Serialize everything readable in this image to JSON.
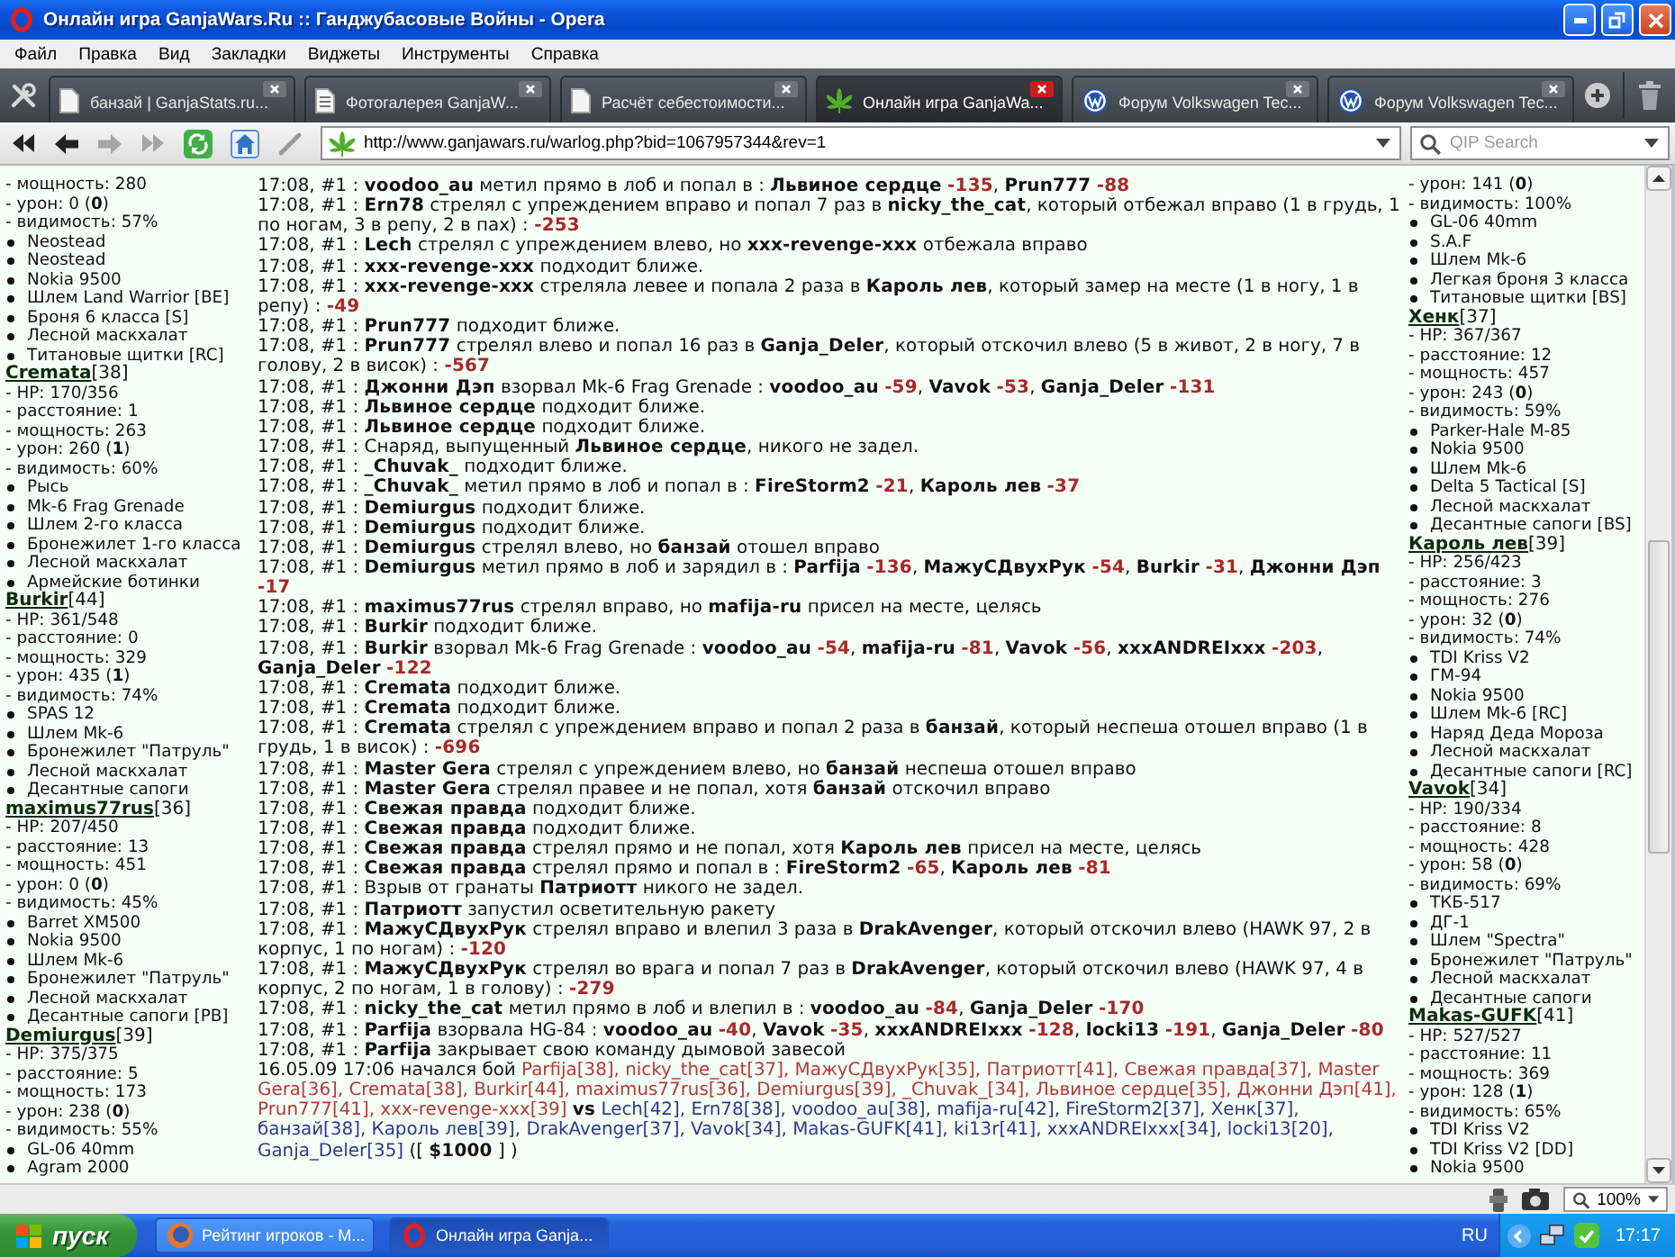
{
  "window": {
    "title": "Онлайн игра GanjaWars.Ru :: Ганджубасовые Войны - Opera"
  },
  "menu": [
    "Файл",
    "Правка",
    "Вид",
    "Закладки",
    "Виджеты",
    "Инструменты",
    "Справка"
  ],
  "tabs": [
    {
      "label": "банзай | GanjaStats.ru...",
      "kind": "page",
      "selected": false
    },
    {
      "label": "Фотогалерея GanjaW...",
      "kind": "document",
      "selected": false
    },
    {
      "label": "Расчёт себестоимости...",
      "kind": "page",
      "selected": false
    },
    {
      "label": "Онлайн игра GanjaWa...",
      "kind": "leaf",
      "selected": true
    },
    {
      "label": "Форум Volkswagen Tec...",
      "kind": "logo",
      "selected": false
    },
    {
      "label": "Форум Volkswagen Tec...",
      "kind": "logo",
      "selected": false
    }
  ],
  "address_bar": {
    "url": "http://www.ganjawars.ru/warlog.php?bid=1067957344&rev=1"
  },
  "search": {
    "placeholder": "QIP Search"
  },
  "left_panel": {
    "fighters": [
      {
        "stats": [
          "- мощность: 280",
          "- урон: 0 (**0**)",
          "- видимость: 57%"
        ],
        "items": [
          "Neostead",
          "Neostead",
          "Nokia 9500",
          "Шлем Land Warrior [BE]",
          "Броня 6 класса [S]",
          "Лесной маскхалат",
          "Титановые щитки [RC]"
        ]
      },
      {
        "name": "Cremata",
        "grade": "[38]",
        "stats": [
          "- HP: 170/356",
          "- расстояние: 1",
          "- мощность: 263",
          "- урон: 260 (**1**)",
          "- видимость: 60%"
        ],
        "items": [
          "Рысь",
          "Mk-6 Frag Grenade",
          "Шлем 2-го класса",
          "Бронежилет 1-го класса",
          "Лесной маскхалат",
          "Армейские ботинки"
        ]
      },
      {
        "name": "Burkir",
        "grade": "[44]",
        "stats": [
          "- HP: 361/548",
          "- расстояние: 0",
          "- мощность: 329",
          "- урон: 435 (**1**)",
          "- видимость: 74%"
        ],
        "items": [
          "SPAS 12",
          "Шлем Mk-6",
          "Бронежилет \"Патруль\"",
          "Лесной маскхалат",
          "Десантные сапоги"
        ]
      },
      {
        "name": "maximus77rus",
        "grade": "[36]",
        "stats": [
          "- HP: 207/450",
          "- расстояние: 13",
          "- мощность: 451",
          "- урон: 0 (**0**)",
          "- видимость: 45%"
        ],
        "items": [
          "Barret XM500",
          "Nokia 9500",
          "Шлем Mk-6",
          "Бронежилет \"Патруль\"",
          "Лесной маскхалат",
          "Десантные сапоги [PB]"
        ]
      },
      {
        "name": "Demiurgus",
        "grade": "[39]",
        "stats": [
          "- HP: 375/375",
          "- расстояние: 5",
          "- мощность: 173",
          "- урон: 238 (**0**)",
          "- видимость: 55%"
        ],
        "items": [
          "GL-06 40mm",
          "Agram 2000"
        ]
      }
    ]
  },
  "log": [
    {
      "time": "17:08, #1 :",
      "parts": [
        {
          "kind": "text",
          "text": "**voodoo_au** метил прямо в лоб и попал в : **Львиное сердце**"
        },
        {
          "kind": "damage",
          "text": "-135"
        },
        {
          "kind": "text",
          "text": ", **Prun777**"
        },
        {
          "kind": "damage",
          "text": "-88"
        }
      ]
    },
    {
      "time": "17:08, #1 :",
      "parts": [
        {
          "kind": "text",
          "text": "**Ern78** стрелял с упреждением вправо и попал 7 раз в **nicky_the_cat**, который отбежал вправо (1 в грудь, 1 по ногам, 3 в репу, 2 в пах) :"
        },
        {
          "kind": "damage",
          "text": "-253"
        }
      ]
    },
    {
      "time": "17:08, #1 :",
      "parts": [
        {
          "kind": "text",
          "text": "**Lech** стрелял с упреждением влево, но **xxx-revenge-xxx** отбежала вправо"
        }
      ]
    },
    {
      "time": "17:08, #1 :",
      "parts": [
        {
          "kind": "text",
          "text": "**xxx-revenge-xxx** подходит ближе."
        }
      ]
    },
    {
      "time": "17:08, #1 :",
      "parts": [
        {
          "kind": "text",
          "text": "**xxx-revenge-xxx** стреляла левее и попала 2 раза в **Кароль лев**, который замер на месте (1 в ногу, 1 в репу) :"
        },
        {
          "kind": "damage",
          "text": "-49"
        }
      ]
    },
    {
      "time": "17:08, #1 :",
      "parts": [
        {
          "kind": "text",
          "text": "**Prun777** подходит ближе."
        }
      ]
    },
    {
      "time": "17:08, #1 :",
      "parts": [
        {
          "kind": "text",
          "text": "**Prun777** стрелял влево и попал 16 раз в **Ganja_Deler**, который отскочил влево (5 в живот, 2 в ногу, 7 в голову, 2 в висок) :"
        },
        {
          "kind": "damage",
          "text": "-567"
        }
      ]
    },
    {
      "time": "17:08, #1 :",
      "parts": [
        {
          "kind": "text",
          "text": "**Джонни Дэп** взорвал Mk-6 Frag Grenade : **voodoo_au**"
        },
        {
          "kind": "damage",
          "text": "-59"
        },
        {
          "kind": "text",
          "text": ", **Vavok**"
        },
        {
          "kind": "damage",
          "text": "-53"
        },
        {
          "kind": "text",
          "text": ", **Ganja_Deler**"
        },
        {
          "kind": "damage",
          "text": "-131"
        }
      ]
    },
    {
      "time": "17:08, #1 :",
      "parts": [
        {
          "kind": "text",
          "text": "**Львиное сердце** подходит ближе."
        }
      ]
    },
    {
      "time": "17:08, #1 :",
      "parts": [
        {
          "kind": "text",
          "text": "**Львиное сердце** подходит ближе."
        }
      ]
    },
    {
      "time": "17:08, #1 :",
      "parts": [
        {
          "kind": "text",
          "text": "Снаряд, выпущенный **Львиное сердце**, никого не задел."
        }
      ]
    },
    {
      "time": "17:08, #1 :",
      "parts": [
        {
          "kind": "text",
          "text": "**_Chuvak_** подходит ближе."
        }
      ]
    },
    {
      "time": "17:08, #1 :",
      "parts": [
        {
          "kind": "text",
          "text": "**_Chuvak_** метил прямо в лоб и попал в : **FireStorm2**"
        },
        {
          "kind": "damage",
          "text": "-21"
        },
        {
          "kind": "text",
          "text": ", **Кароль лев**"
        },
        {
          "kind": "damage",
          "text": "-37"
        }
      ]
    },
    {
      "time": "17:08, #1 :",
      "parts": [
        {
          "kind": "text",
          "text": "**Demiurgus** подходит ближе."
        }
      ]
    },
    {
      "time": "17:08, #1 :",
      "parts": [
        {
          "kind": "text",
          "text": "**Demiurgus** подходит ближе."
        }
      ]
    },
    {
      "time": "17:08, #1 :",
      "parts": [
        {
          "kind": "text",
          "text": "**Demiurgus** стрелял влево, но **банзай** отошел вправо"
        }
      ]
    },
    {
      "time": "17:08, #1 :",
      "parts": [
        {
          "kind": "text",
          "text": "**Demiurgus** метил прямо в лоб и зарядил в : **Parfija**"
        },
        {
          "kind": "damage",
          "text": "-136"
        },
        {
          "kind": "text",
          "text": ", **МажуСДвухРук**"
        },
        {
          "kind": "damage",
          "text": "-54"
        },
        {
          "kind": "text",
          "text": ", **Burkir**"
        },
        {
          "kind": "damage",
          "text": "-31"
        },
        {
          "kind": "text",
          "text": ", **Джонни Дэп**"
        },
        {
          "kind": "damage",
          "text": "-17"
        }
      ]
    },
    {
      "time": "17:08, #1 :",
      "parts": [
        {
          "kind": "text",
          "text": "**maximus77rus** стрелял вправо, но **mafija-ru** присел на месте, целясь"
        }
      ]
    },
    {
      "time": "17:08, #1 :",
      "parts": [
        {
          "kind": "text",
          "text": "**Burkir** подходит ближе."
        }
      ]
    },
    {
      "time": "17:08, #1 :",
      "parts": [
        {
          "kind": "text",
          "text": "**Burkir** взорвал Mk-6 Frag Grenade : **voodoo_au**"
        },
        {
          "kind": "damage",
          "text": "-54"
        },
        {
          "kind": "text",
          "text": ", **mafija-ru**"
        },
        {
          "kind": "damage",
          "text": "-81"
        },
        {
          "kind": "text",
          "text": ", **Vavok**"
        },
        {
          "kind": "damage",
          "text": "-56"
        },
        {
          "kind": "text",
          "text": ", **xxxANDREIxxx**"
        },
        {
          "kind": "damage",
          "text": "-203"
        },
        {
          "kind": "text",
          "text": ", **Ganja_Deler**"
        },
        {
          "kind": "damage",
          "text": "-122"
        }
      ]
    },
    {
      "time": "17:08, #1 :",
      "parts": [
        {
          "kind": "text",
          "text": "**Cremata** подходит ближе."
        }
      ]
    },
    {
      "time": "17:08, #1 :",
      "parts": [
        {
          "kind": "text",
          "text": "**Cremata** подходит ближе."
        }
      ]
    },
    {
      "time": "17:08, #1 :",
      "parts": [
        {
          "kind": "text",
          "text": "**Cremata** стрелял с упреждением вправо и попал 2 раза в **банзай**, который неспеша отошел вправо (1 в грудь, 1 в висок) :"
        },
        {
          "kind": "damage",
          "text": "-696"
        }
      ]
    },
    {
      "time": "17:08, #1 :",
      "parts": [
        {
          "kind": "text",
          "text": "**Master Gera** стрелял с упреждением влево, но **банзай** неспеша отошел вправо"
        }
      ]
    },
    {
      "time": "17:08, #1 :",
      "parts": [
        {
          "kind": "text",
          "text": "**Master Gera** стрелял правее и не попал, хотя **банзай** отскочил вправо"
        }
      ]
    },
    {
      "time": "17:08, #1 :",
      "parts": [
        {
          "kind": "text",
          "text": "**Свежая правда** подходит ближе."
        }
      ]
    },
    {
      "time": "17:08, #1 :",
      "parts": [
        {
          "kind": "text",
          "text": "**Свежая правда** подходит ближе."
        }
      ]
    },
    {
      "time": "17:08, #1 :",
      "parts": [
        {
          "kind": "text",
          "text": "**Свежая правда** стрелял прямо и не попал, хотя **Кароль лев** присел на месте, целясь"
        }
      ]
    },
    {
      "time": "17:08, #1 :",
      "parts": [
        {
          "kind": "text",
          "text": "**Свежая правда** стрелял прямо и попал в : **FireStorm2**"
        },
        {
          "kind": "damage",
          "text": "-65"
        },
        {
          "kind": "text",
          "text": ", **Кароль лев**"
        },
        {
          "kind": "damage",
          "text": "-81"
        }
      ]
    },
    {
      "time": "17:08, #1 :",
      "parts": [
        {
          "kind": "text",
          "text": "Взрыв от гранаты **Патриотт** никого не задел."
        }
      ]
    },
    {
      "time": "17:08, #1 :",
      "parts": [
        {
          "kind": "text",
          "text": "**Патриотт** запустил осветительную ракету"
        }
      ]
    },
    {
      "time": "17:08, #1 :",
      "parts": [
        {
          "kind": "text",
          "text": "**МажуСДвухРук** стрелял вправо и влепил 3 раза в **DrakAvenger**, который отскочил влево (HAWK 97, 2 в корпус, 1 по ногам) :"
        },
        {
          "kind": "damage",
          "text": "-120"
        }
      ]
    },
    {
      "time": "17:08, #1 :",
      "parts": [
        {
          "kind": "text",
          "text": "**МажуСДвухРук** стрелял во врага и попал 7 раз в **DrakAvenger**, который отскочил влево (HAWK 97, 4 в корпус, 2 по ногам, 1 в голову) :"
        },
        {
          "kind": "damage",
          "text": "-279"
        }
      ]
    },
    {
      "time": "17:08, #1 :",
      "parts": [
        {
          "kind": "text",
          "text": "**nicky_the_cat** метил прямо в лоб и влепил в : **voodoo_au**"
        },
        {
          "kind": "damage",
          "text": "-84"
        },
        {
          "kind": "text",
          "text": ", **Ganja_Deler**"
        },
        {
          "kind": "damage",
          "text": "-170"
        }
      ]
    },
    {
      "time": "17:08, #1 :",
      "parts": [
        {
          "kind": "text",
          "text": "**Parfija** взорвала HG-84 : **voodoo_au**"
        },
        {
          "kind": "damage",
          "text": "-40"
        },
        {
          "kind": "text",
          "text": ", **Vavok**"
        },
        {
          "kind": "damage",
          "text": "-35"
        },
        {
          "kind": "text",
          "text": ", **xxxANDREIxxx**"
        },
        {
          "kind": "damage",
          "text": "-128"
        },
        {
          "kind": "text",
          "text": ", **locki13**"
        },
        {
          "kind": "damage",
          "text": "-191"
        },
        {
          "kind": "text",
          "text": ", **Ganja_Deler**"
        },
        {
          "kind": "damage",
          "text": "-80"
        }
      ]
    },
    {
      "time": "17:08, #1 :",
      "parts": [
        {
          "kind": "text",
          "text": "**Parfija** закрывает свою команду дымовой завесой"
        }
      ]
    },
    {
      "parts": [
        {
          "kind": "text",
          "text": "16.05.09 17:06 начался бой "
        },
        {
          "kind": "team_a",
          "text": "Parfija[38], nicky_the_cat[37], МажуСДвухРук[35], Патриотт[41], Свежая правда[37], Master Gera[36], Cremata[38], Burkir[44], maximus77rus[36], Demiurgus[39], _Chuvak_[34], Львиное сердце[35], Джонни Дэп[41], Prun777[41], xxx-revenge-xxx[39]"
        },
        {
          "kind": "text",
          "text": " **vs** "
        },
        {
          "kind": "team_b",
          "text": "Lech[42], Ern78[38], voodoo_au[38], mafija-ru[42], FireStorm2[37], Хенк[37], банзай[38], Кароль лев[39], DrakAvenger[37], Vavok[34], Makas-GUFK[41], ki13r[41], xxxANDREIxxx[34], locki13[20], Ganja_Deler[35]"
        },
        {
          "kind": "text",
          "text": " ([ **$1000** ] )"
        }
      ]
    }
  ],
  "right_panel": {
    "fighters": [
      {
        "stats": [
          "- урон: 141 (**0**)",
          "- видимость: 100%"
        ],
        "items": [
          "GL-06 40mm",
          "S.A.F",
          "Шлем Mk-6",
          "Легкая броня 3 класса",
          "Титановые щитки [BS]"
        ]
      },
      {
        "name": "Хенк",
        "grade": "[37]",
        "stats": [
          "- HP: 367/367",
          "- расстояние: 12",
          "- мощность: 457",
          "- урон: 243 (**0**)",
          "- видимость: 59%"
        ],
        "items": [
          "Parker-Hale M-85",
          "Nokia 9500",
          "Шлем Mk-6",
          "Delta 5 Tactical [S]",
          "Лесной маскхалат",
          "Десантные сапоги [BS]"
        ]
      },
      {
        "name": "Кароль лев",
        "grade": "[39]",
        "stats": [
          "- HP: 256/423",
          "- расстояние: 3",
          "- мощность: 276",
          "- урон: 32 (**0**)",
          "- видимость: 74%"
        ],
        "items": [
          "TDI Kriss V2",
          "ГМ-94",
          "Nokia 9500",
          "Шлем Mk-6 [RC]",
          "Наряд Деда Мороза",
          "Лесной маскхалат",
          "Десантные сапоги [RC]"
        ]
      },
      {
        "name": "Vavok",
        "grade": "[34]",
        "stats": [
          "- HP: 190/334",
          "- расстояние: 8",
          "- мощность: 428",
          "- урон: 58 (**0**)",
          "- видимость: 69%"
        ],
        "items": [
          "ТКБ-517",
          "ДГ-1",
          "Шлем \"Spectra\"",
          "Бронежилет \"Патруль\"",
          "Лесной маскхалат",
          "Десантные сапоги"
        ]
      },
      {
        "name": "Makas-GUFK",
        "grade": "[41]",
        "stats": [
          "- HP: 527/527",
          "- расстояние: 11",
          "- мощность: 369",
          "- урон: 128 (**1**)",
          "- видимость: 65%"
        ],
        "items": [
          "TDI Kriss V2",
          "TDI Kriss V2 [DD]",
          "Nokia 9500"
        ]
      }
    ]
  },
  "status_bar": {
    "zoom": "100%"
  },
  "taskbar": {
    "start": "пуск",
    "tasks": [
      {
        "label": "Рейтинг игроков - M...",
        "kind": "globe",
        "selected": false
      },
      {
        "label": "Онлайн игра Ganja...",
        "kind": "ring",
        "selected": true
      }
    ],
    "language": "RU",
    "clock": "17:17"
  }
}
